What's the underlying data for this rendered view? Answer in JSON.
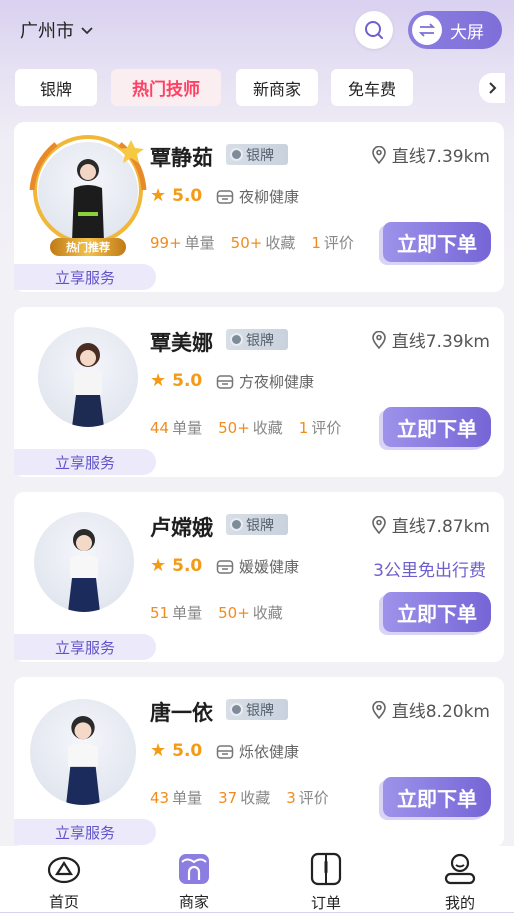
{
  "header": {
    "city": "广州市",
    "bigscreen_label": "大屏"
  },
  "tabs": [
    "银牌",
    "热门技师",
    "新商家",
    "免车费"
  ],
  "active_tab": "热门技师",
  "cards": [
    {
      "name": "覃静茹",
      "tier": "银牌",
      "distance": "直线7.39km",
      "rating": "5.0",
      "shop": "夜柳健康",
      "promo": "",
      "stats": [
        {
          "n": "99+",
          "l": "单量"
        },
        {
          "n": "50+",
          "l": "收藏"
        },
        {
          "n": "1",
          "l": "评价"
        }
      ],
      "hot": "热门推荐",
      "serve": "立享服务",
      "order": "立即下单"
    },
    {
      "name": "覃美娜",
      "tier": "银牌",
      "distance": "直线7.39km",
      "rating": "5.0",
      "shop": "方夜柳健康",
      "promo": "",
      "stats": [
        {
          "n": "44",
          "l": "单量"
        },
        {
          "n": "50+",
          "l": "收藏"
        },
        {
          "n": "1",
          "l": "评价"
        }
      ],
      "hot": "",
      "serve": "立享服务",
      "order": "立即下单"
    },
    {
      "name": "卢嫦娥",
      "tier": "银牌",
      "distance": "直线7.87km",
      "rating": "5.0",
      "shop": "媛媛健康",
      "promo": "3公里免出行费",
      "stats": [
        {
          "n": "51",
          "l": "单量"
        },
        {
          "n": "50+",
          "l": "收藏"
        }
      ],
      "hot": "",
      "serve": "立享服务",
      "order": "立即下单"
    },
    {
      "name": "唐一依",
      "tier": "银牌",
      "distance": "直线8.20km",
      "rating": "5.0",
      "shop": "烁依健康",
      "promo": "",
      "stats": [
        {
          "n": "43",
          "l": "单量"
        },
        {
          "n": "37",
          "l": "收藏"
        },
        {
          "n": "3",
          "l": "评价"
        }
      ],
      "hot": "",
      "serve": "立享服务",
      "order": "立即下单"
    }
  ],
  "bottom_nav": [
    {
      "label": "首页",
      "icon": "home-icon"
    },
    {
      "label": "商家",
      "icon": "shop-icon"
    },
    {
      "label": "订单",
      "icon": "order-icon"
    },
    {
      "label": "我的",
      "icon": "profile-icon"
    }
  ],
  "colors": {
    "accent": "#7d6fd8",
    "hot": "#ff4064",
    "orange": "#f39b15"
  }
}
